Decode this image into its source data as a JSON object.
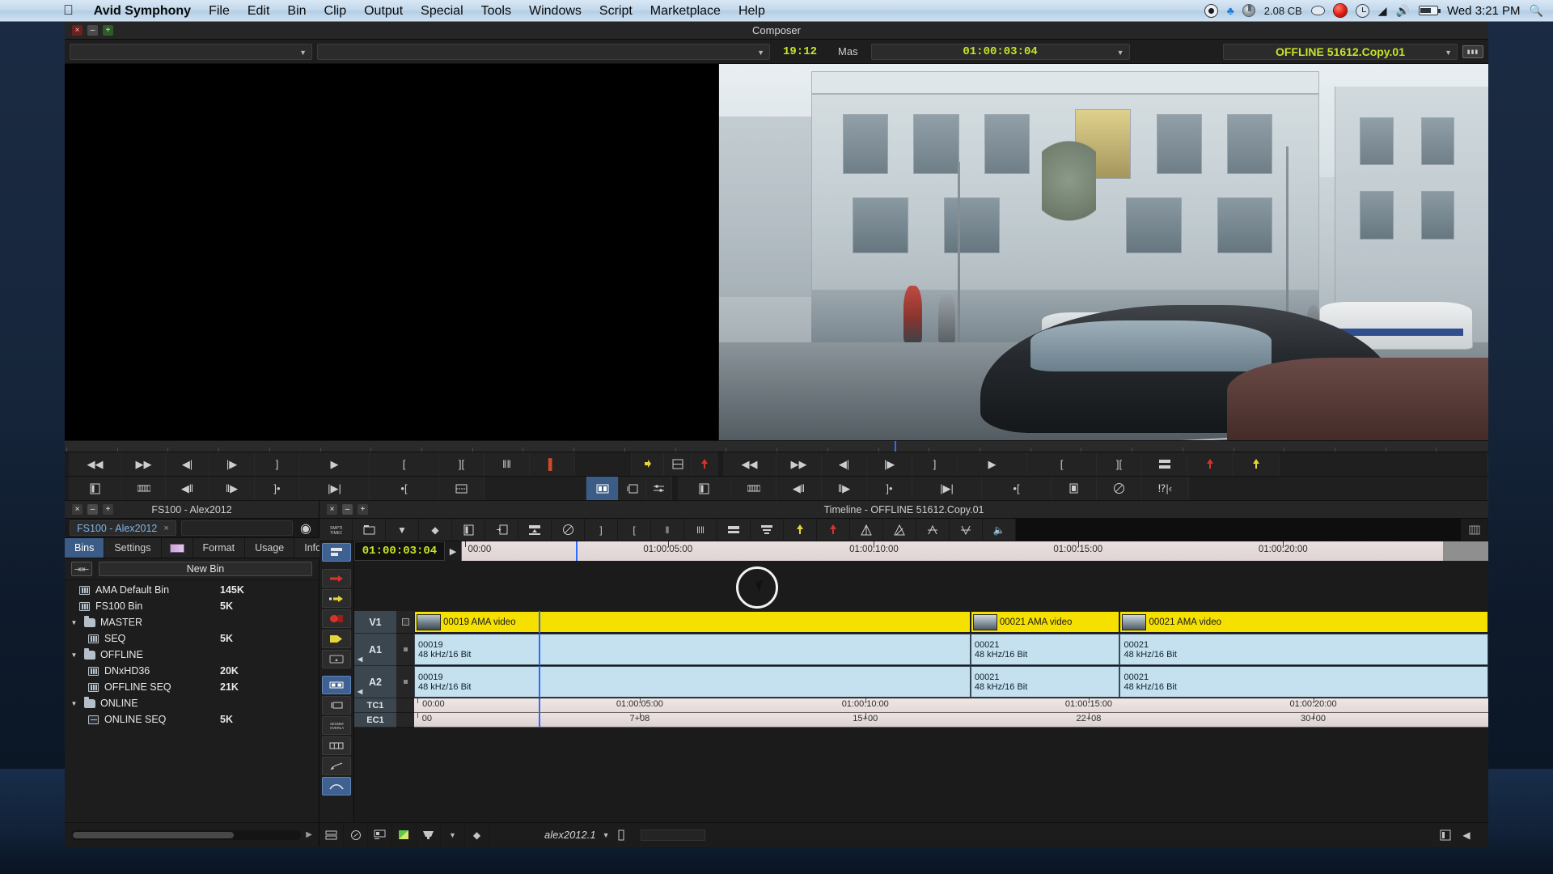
{
  "menubar": {
    "apple_icon": "apple-icon",
    "items": [
      "Avid Symphony",
      "File",
      "Edit",
      "Bin",
      "Clip",
      "Output",
      "Special",
      "Tools",
      "Windows",
      "Script",
      "Marketplace",
      "Help"
    ],
    "status_icons": [
      "record-icon",
      "dropbox-icon",
      "disk-icon",
      "eject-icon",
      "alert-red-icon",
      "timemachine-icon",
      "wifi-icon",
      "volume-icon",
      "battery-icon"
    ],
    "disk_size": "2.08 CB",
    "clock": "Wed 3:21 PM",
    "search_icon": "spotlight-search-icon"
  },
  "composer": {
    "title": "Composer",
    "window_buttons": {
      "close": "×",
      "minimize": "–",
      "maximize": "+"
    },
    "source_select_value": "",
    "duration": "19:12",
    "mode": "Mas",
    "record_timecode": "01:00:03:04",
    "offline_label": "OFFLINE 51612.Copy.01",
    "keyboard_icon": "keyboard-icon"
  },
  "transport": {
    "row1_left": [
      "rewind-icon",
      "fast-forward-icon",
      "step-back-icon",
      "step-forward-icon",
      "mark-out-icon",
      "play-icon",
      "mark-in-icon",
      "mark-clip-icon",
      "mark-clip-alt-icon",
      "red-mark-icon"
    ],
    "row2_left": [
      "film-icon",
      "render-icon",
      "trim-back-icon",
      "trim-forward-icon",
      "lift-icon",
      "overwrite-icon",
      "splice-icon",
      "extract-icon"
    ],
    "row1_right": [
      "add-edit-icon",
      "match-frame-icon",
      "record-red-icon",
      "rewind-icon",
      "fast-forward-icon",
      "step-back-icon",
      "step-forward-icon",
      "mark-out-icon",
      "play-icon",
      "mark-in-icon",
      "mark-clip-icon",
      "quick-transition-icon",
      "lift-red-icon",
      "overwrite-yellow-icon"
    ],
    "row2_right": [
      "grid-icon",
      "source-icon",
      "effect-mode-icon",
      "film-icon",
      "render-icon",
      "trim-back-icon",
      "trim-forward-icon",
      "lift-icon",
      "overwrite-icon",
      "splice-icon",
      "extract-icon",
      "no-effect-icon",
      "collapse-icon",
      "copy-icon"
    ]
  },
  "project": {
    "title": "FS100 - Alex2012",
    "window_buttons": {
      "close": "×",
      "minimize": "–",
      "maximize": "+"
    },
    "tab_label": "FS100 - Alex2012",
    "tab_close": "×",
    "gear_icon": "project-menu-icon",
    "tabs": [
      {
        "label": "Bins",
        "active": true
      },
      {
        "label": "Settings",
        "active": false
      },
      {
        "label": "",
        "active": false,
        "icon": "format-swatch-icon"
      },
      {
        "label": "Format",
        "active": false
      },
      {
        "label": "Usage",
        "active": false
      },
      {
        "label": "Info",
        "active": false
      }
    ],
    "new_bin_label": "New Bin",
    "new_bin_icon": "bin-split-icon",
    "bins": [
      {
        "name": "AMA Default Bin",
        "size": "145K",
        "type": "bin",
        "indent": 1,
        "expandable": false
      },
      {
        "name": "FS100 Bin",
        "size": "5K",
        "type": "bin",
        "indent": 1,
        "expandable": false
      },
      {
        "name": "MASTER",
        "size": "",
        "type": "folder",
        "indent": 0,
        "expandable": true,
        "expanded": true
      },
      {
        "name": "SEQ",
        "size": "5K",
        "type": "bin",
        "indent": 2,
        "expandable": false
      },
      {
        "name": "OFFLINE",
        "size": "",
        "type": "folder",
        "indent": 0,
        "expandable": true,
        "expanded": true
      },
      {
        "name": "DNxHD36",
        "size": "20K",
        "type": "bin",
        "indent": 2,
        "expandable": false
      },
      {
        "name": "OFFLINE SEQ",
        "size": "21K",
        "type": "bin",
        "indent": 2,
        "expandable": false
      },
      {
        "name": "ONLINE",
        "size": "",
        "type": "folder",
        "indent": 0,
        "expandable": true,
        "expanded": true
      },
      {
        "name": "ONLINE SEQ",
        "size": "5K",
        "type": "seq",
        "indent": 2,
        "expandable": false
      }
    ]
  },
  "timeline": {
    "title": "Timeline - OFFLINE 51612.Copy.01",
    "window_buttons": {
      "close": "×",
      "minimize": "–",
      "maximize": "+"
    },
    "current_timecode": "01:00:03:04",
    "play_icon": "play-triangle-icon",
    "toolbar_icons": [
      "timecode-icon",
      "source-browser-icon",
      "dropdown-icon",
      "focus-icon",
      "film-icon",
      "match-frame-icon",
      "render-icon",
      "no-effect-icon",
      "mark-out-icon",
      "mark-in-icon",
      "mark-clip-icon",
      "mark-clip-alt-icon",
      "quick-transition-icon",
      "remove-effect-icon",
      "lift-yellow-icon",
      "overwrite-red-icon",
      "trim-a-icon",
      "trim-b-icon",
      "trim-c-icon",
      "trim-d-icon",
      "audio-icon"
    ],
    "left_tool_icons": [
      "track-panel-icon",
      "red-arrow-icon",
      "yellow-arrow-icon",
      "red-record-icon",
      "yellow-speaker-icon",
      "mark-box-icon",
      "dual-roller-icon",
      "single-roller-icon",
      "smart-tool-icon",
      "segment-icon",
      "effect-brush-icon",
      "curve-icon"
    ],
    "ruler_labels": [
      {
        "text": "00:00",
        "pos_pct": 0.3
      },
      {
        "text": "01:00:05:00",
        "pos_pct": 21.0
      },
      {
        "text": "01:00:10:00",
        "pos_pct": 42.0
      },
      {
        "text": "01:00:15:00",
        "pos_pct": 62.8
      },
      {
        "text": "01:00:20:00",
        "pos_pct": 83.7
      }
    ],
    "playhead_pct": 14.0,
    "tracks": [
      {
        "name": "V1",
        "type": "video",
        "monitor": true
      },
      {
        "name": "A1",
        "type": "audio",
        "monitor": false
      },
      {
        "name": "A2",
        "type": "audio",
        "monitor": false
      }
    ],
    "video_clips": [
      {
        "label": "00019 AMA video",
        "left_pct": 0.0,
        "width_pct": 51.8,
        "thumb": "p1"
      },
      {
        "label": "00021 AMA video",
        "left_pct": 51.8,
        "width_pct": 13.9,
        "thumb": "p2"
      },
      {
        "label": "00021 AMA video",
        "left_pct": 65.7,
        "width_pct": 34.3,
        "thumb": "p2"
      }
    ],
    "audio_clips": [
      {
        "name": "00019",
        "format": "48 kHz/16 Bit",
        "left_pct": 0.0,
        "width_pct": 51.8
      },
      {
        "name": "00021",
        "format": "48 kHz/16 Bit",
        "left_pct": 51.8,
        "width_pct": 13.9
      },
      {
        "name": "00021",
        "format": "48 kHz/16 Bit",
        "left_pct": 65.7,
        "width_pct": 34.3
      }
    ],
    "tc_track": {
      "name": "TC1",
      "labels": [
        {
          "text": "00:00",
          "pos_pct": 0.3
        },
        {
          "text": "01:00:05:00",
          "pos_pct": 21.0
        },
        {
          "text": "01:00:10:00",
          "pos_pct": 42.0
        },
        {
          "text": "01:00:15:00",
          "pos_pct": 62.8
        },
        {
          "text": "01:00:20:00",
          "pos_pct": 83.7
        }
      ]
    },
    "ec_track": {
      "name": "EC1",
      "labels": [
        {
          "text": "00",
          "pos_pct": 0.3
        },
        {
          "text": "7+08",
          "pos_pct": 21.0
        },
        {
          "text": "15+00",
          "pos_pct": 42.0
        },
        {
          "text": "22+08",
          "pos_pct": 62.8
        },
        {
          "text": "30+00",
          "pos_pct": 83.7
        }
      ]
    },
    "bottom_bar": {
      "sequence_name": "alex2012.1",
      "icons": [
        "track-panel-icon",
        "audio-meter-icon",
        "video-quality-icon",
        "green-quality-icon",
        "monitor-icon",
        "dropdown-icon",
        "focus-icon",
        "zoom-icon"
      ],
      "right_icons": [
        "film-icon",
        "scroll-left-icon"
      ]
    }
  },
  "colors": {
    "accent_blue": "#3a5c86",
    "playhead": "#2f6bff",
    "video_clip": "#f5e000",
    "audio_clip": "#c5e0ee",
    "timecode_green": "#c9e22a",
    "track_header": "#3c464e"
  }
}
